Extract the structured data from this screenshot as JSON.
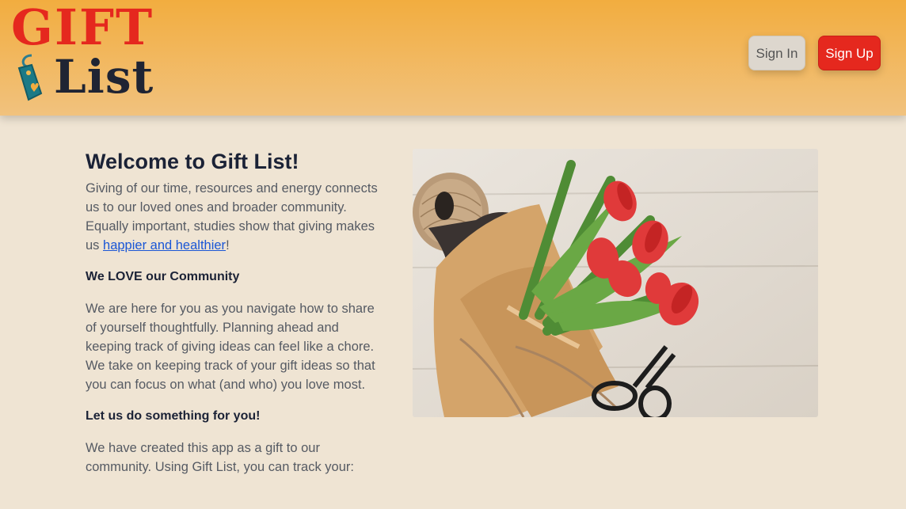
{
  "logo": {
    "line1": "GIFT",
    "line2": "List"
  },
  "nav": {
    "signin_label": "Sign In",
    "signup_label": "Sign Up"
  },
  "welcome": {
    "title": "Welcome to Gift List!",
    "intro_text": "Giving of our time, resources and energy connects us to our loved ones and broader community. Equally important, studies show that giving makes us ",
    "intro_link": "happier and healthier",
    "intro_end": "!",
    "community_heading": "We LOVE our Community",
    "community_text": "We are here for you as you navigate how to share of yourself thoughtfully. Planning ahead and keeping track of giving ideas can feel like a chore. We take on keeping track of your gift ideas so that you can focus on what (and who) you love most.",
    "help_heading": "Let us do something for you!",
    "help_text": "We have created this app as a gift to our community. Using Gift List, you can track your:"
  },
  "colors": {
    "header": "#f2ad3f",
    "background": "#efe4d3",
    "signup": "#e5281e",
    "link": "#1a56d6"
  }
}
